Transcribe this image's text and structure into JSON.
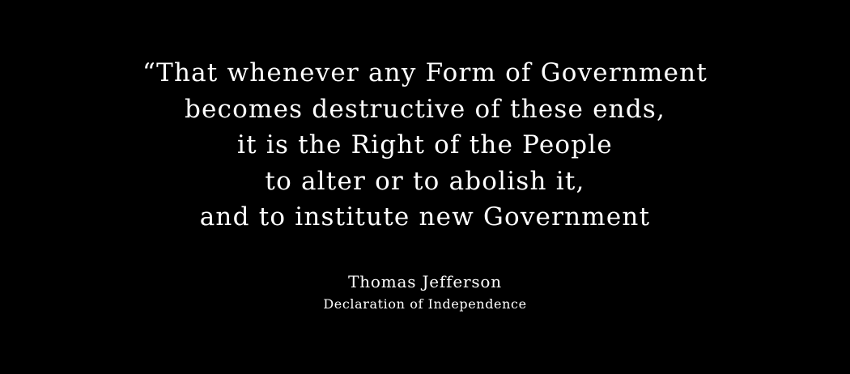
{
  "quote": {
    "lines": [
      "“That whenever any Form of Government",
      "becomes destructive of these ends,",
      "it is the Right of the People",
      "to alter or to abolish it,",
      "and to institute new Government"
    ]
  },
  "attribution": {
    "author": "Thomas Jefferson",
    "source": "Declaration of Independence"
  },
  "colors": {
    "background": "#000000",
    "text": "#ffffff"
  }
}
